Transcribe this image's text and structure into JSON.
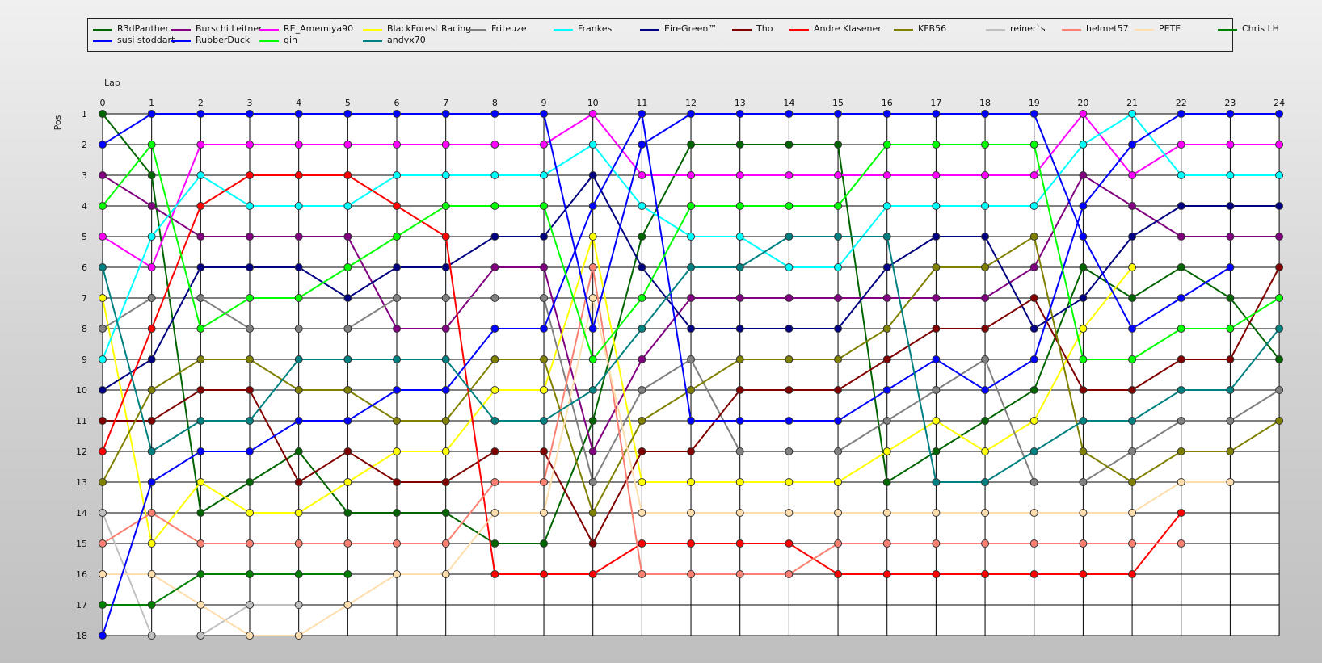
{
  "chart_data": {
    "type": "line",
    "xlabel": "Lap",
    "ylabel": "Pos",
    "x": [
      0,
      1,
      2,
      3,
      4,
      5,
      6,
      7,
      8,
      9,
      10,
      11,
      12,
      13,
      14,
      15,
      16,
      17,
      18,
      19,
      20,
      21,
      22,
      23,
      24
    ],
    "ylim": [
      1,
      18
    ],
    "y_inverted": true,
    "grid": true,
    "legend_position": "top",
    "series": [
      {
        "name": "R3dPanther",
        "color": "#006400",
        "values": [
          1,
          3,
          14,
          13,
          12,
          14,
          14,
          14,
          15,
          15,
          11,
          5,
          2,
          2,
          2,
          2,
          13,
          12,
          11,
          10,
          6,
          7,
          6,
          7,
          9
        ]
      },
      {
        "name": "Burschi Leitner",
        "color": "#800080",
        "values": [
          3,
          4,
          5,
          5,
          5,
          5,
          8,
          8,
          6,
          6,
          12,
          9,
          7,
          7,
          7,
          7,
          7,
          7,
          7,
          6,
          3,
          4,
          5,
          5,
          5
        ]
      },
      {
        "name": "RE_Amemiya90",
        "color": "#ff00ff",
        "values": [
          5,
          6,
          2,
          2,
          2,
          2,
          2,
          2,
          2,
          2,
          1,
          3,
          3,
          3,
          3,
          3,
          3,
          3,
          3,
          3,
          1,
          3,
          2,
          2,
          2
        ]
      },
      {
        "name": "BlackForest Racing",
        "color": "#ffff00",
        "values": [
          7,
          15,
          13,
          14,
          14,
          13,
          12,
          12,
          10,
          10,
          5,
          13,
          13,
          13,
          13,
          13,
          12,
          11,
          12,
          11,
          8,
          6,
          null,
          null,
          null
        ]
      },
      {
        "name": "Friteuze",
        "color": "#808080",
        "values": [
          8,
          7,
          7,
          8,
          8,
          8,
          7,
          7,
          7,
          7,
          13,
          10,
          9,
          12,
          12,
          12,
          11,
          10,
          9,
          13,
          13,
          12,
          11,
          11,
          10
        ]
      },
      {
        "name": "Frankes",
        "color": "#00ffff",
        "values": [
          9,
          5,
          3,
          4,
          4,
          4,
          3,
          3,
          3,
          3,
          2,
          4,
          5,
          5,
          6,
          6,
          4,
          4,
          4,
          4,
          2,
          1,
          3,
          3,
          3
        ]
      },
      {
        "name": "EireGreen™",
        "color": "#000080",
        "values": [
          10,
          9,
          6,
          6,
          6,
          7,
          6,
          6,
          5,
          5,
          3,
          6,
          8,
          8,
          8,
          8,
          6,
          5,
          5,
          8,
          7,
          5,
          4,
          4,
          4
        ]
      },
      {
        "name": "Tho",
        "color": "#800000",
        "values": [
          11,
          11,
          10,
          10,
          13,
          12,
          13,
          13,
          12,
          12,
          15,
          12,
          12,
          10,
          10,
          10,
          9,
          8,
          8,
          7,
          10,
          10,
          9,
          9,
          6
        ]
      },
      {
        "name": "Andre Klasener",
        "color": "#ff0000",
        "values": [
          12,
          8,
          4,
          3,
          3,
          3,
          4,
          5,
          16,
          16,
          16,
          15,
          15,
          15,
          15,
          16,
          16,
          16,
          16,
          16,
          16,
          16,
          14,
          null,
          null
        ]
      },
      {
        "name": "KFB56",
        "color": "#808000",
        "values": [
          13,
          10,
          9,
          9,
          10,
          10,
          11,
          11,
          9,
          9,
          14,
          11,
          10,
          9,
          9,
          9,
          8,
          6,
          6,
          5,
          12,
          13,
          12,
          12,
          11
        ]
      },
      {
        "name": "reiner`s",
        "color": "#c0c0c0",
        "values": [
          14,
          18,
          18,
          17,
          17,
          null,
          null,
          null,
          null,
          null,
          null,
          null,
          null,
          null,
          null,
          null,
          null,
          null,
          null,
          null,
          null,
          null,
          null,
          null,
          null
        ]
      },
      {
        "name": "helmet57",
        "color": "#fa8072",
        "values": [
          15,
          14,
          15,
          15,
          15,
          15,
          15,
          15,
          13,
          13,
          6,
          16,
          16,
          16,
          16,
          15,
          15,
          15,
          15,
          15,
          15,
          15,
          15,
          null,
          null
        ]
      },
      {
        "name": "PETE",
        "color": "#ffdead",
        "values": [
          16,
          16,
          17,
          18,
          18,
          17,
          16,
          16,
          14,
          14,
          7,
          14,
          14,
          14,
          14,
          14,
          14,
          14,
          14,
          14,
          14,
          14,
          13,
          13,
          null
        ]
      },
      {
        "name": "Chris LH",
        "color": "#008000",
        "values": [
          17,
          17,
          16,
          16,
          16,
          16,
          null,
          null,
          null,
          null,
          null,
          null,
          null,
          null,
          null,
          null,
          null,
          null,
          null,
          null,
          null,
          null,
          null,
          null,
          null
        ]
      },
      {
        "name": "susi stoddart",
        "color": "#0000ff",
        "values": [
          2,
          1,
          1,
          1,
          1,
          1,
          1,
          1,
          1,
          1,
          8,
          2,
          1,
          1,
          1,
          1,
          1,
          1,
          1,
          1,
          5,
          8,
          7,
          6,
          null
        ]
      },
      {
        "name": "RubberDuck",
        "color": "#0000ff",
        "values": [
          18,
          13,
          12,
          12,
          11,
          11,
          10,
          10,
          8,
          8,
          4,
          1,
          11,
          11,
          11,
          11,
          10,
          9,
          10,
          9,
          4,
          2,
          1,
          1,
          1
        ]
      },
      {
        "name": "gin",
        "color": "#00ff00",
        "values": [
          4,
          2,
          8,
          7,
          7,
          6,
          5,
          4,
          4,
          4,
          9,
          7,
          4,
          4,
          4,
          4,
          2,
          2,
          2,
          2,
          9,
          9,
          8,
          8,
          7
        ]
      },
      {
        "name": "andyx70",
        "color": "#008080",
        "values": [
          6,
          12,
          11,
          11,
          9,
          9,
          9,
          9,
          11,
          11,
          10,
          8,
          6,
          6,
          5,
          5,
          5,
          13,
          13,
          12,
          11,
          11,
          10,
          10,
          8
        ]
      }
    ]
  }
}
